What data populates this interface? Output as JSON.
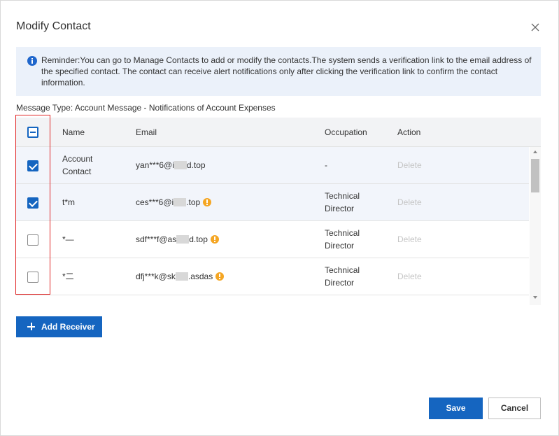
{
  "dialog": {
    "title": "Modify Contact"
  },
  "reminder": {
    "text": "Reminder:You can go to Manage Contacts to add or modify the contacts.The system sends a verification link to the email address of the specified contact. The contact can receive alert notifications only after clicking the verification link to confirm the contact information."
  },
  "message_type": "Message Type: Account Message - Notifications of Account Expenses",
  "table": {
    "headers": {
      "name": "Name",
      "email": "Email",
      "occupation": "Occupation",
      "action": "Action"
    },
    "rows": [
      {
        "checked": true,
        "name_line1": "Account",
        "name_line2": "Contact",
        "email_prefix": "yan***6@i",
        "email_suffix": "d.top",
        "email_warning": false,
        "occupation_line1": "-",
        "occupation_line2": "",
        "action": "Delete"
      },
      {
        "checked": true,
        "name_line1": "t*m",
        "name_line2": "",
        "email_prefix": "ces***6@i",
        "email_suffix": ".top",
        "email_warning": true,
        "occupation_line1": "Technical",
        "occupation_line2": "Director",
        "action": "Delete"
      },
      {
        "checked": false,
        "name_line1": "*—",
        "name_line2": "",
        "email_prefix": "sdf***f@as",
        "email_suffix": "d.top",
        "email_warning": true,
        "occupation_line1": "Technical",
        "occupation_line2": "Director",
        "action": "Delete"
      },
      {
        "checked": false,
        "name_line1": "*二",
        "name_line2": "",
        "email_prefix": "dfj***k@sk",
        "email_suffix": ".asdas",
        "email_warning": true,
        "occupation_line1": "Technical",
        "occupation_line2": "Director",
        "action": "Delete"
      }
    ]
  },
  "buttons": {
    "add_receiver": "Add Receiver",
    "save": "Save",
    "cancel": "Cancel"
  },
  "colors": {
    "primary": "#1565c0",
    "info_bg": "#ebf1fa",
    "warning": "#f5a623",
    "highlight": "#e02424"
  }
}
